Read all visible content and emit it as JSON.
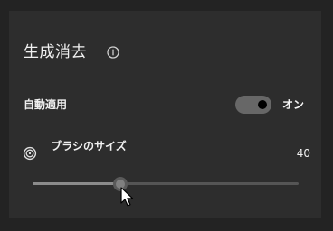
{
  "panel": {
    "title": "生成消去"
  },
  "auto_apply": {
    "label": "自動適用",
    "state_label": "オン",
    "enabled": true
  },
  "brush_size": {
    "label": "ブラシのサイズ",
    "value": "40",
    "slider_fraction": 0.33
  },
  "icons": {
    "info": "info-icon",
    "brush": "target-icon",
    "cursor": "arrow-cursor-icon"
  }
}
